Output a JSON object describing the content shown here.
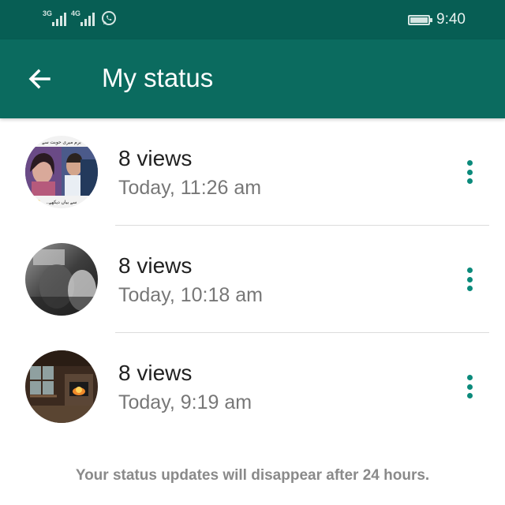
{
  "status_bar": {
    "network1": "3G",
    "network2": "4G",
    "time": "9:40",
    "icons": [
      "signal-icon",
      "whatsapp-icon",
      "battery-icon"
    ]
  },
  "app_bar": {
    "title": "My status",
    "back_icon": "arrow-left-icon"
  },
  "statuses": [
    {
      "views": "8 views",
      "time": "Today, 11:26 am",
      "thumb": "photo-collage-couple",
      "caption_top": "برم میری حوبت سے",
      "caption_bottom": "..سے بیاں دیکھے"
    },
    {
      "views": "8 views",
      "time": "Today, 10:18 am",
      "thumb": "grayscale-photo"
    },
    {
      "views": "8 views",
      "time": "Today, 9:19 am",
      "thumb": "cabin-fireplace-photo"
    }
  ],
  "footer": {
    "note": "Your status updates will disappear after 24 hours."
  },
  "colors": {
    "status_bar": "#075e54",
    "app_bar": "#0b6b5f",
    "accent": "#0b8a7b"
  }
}
